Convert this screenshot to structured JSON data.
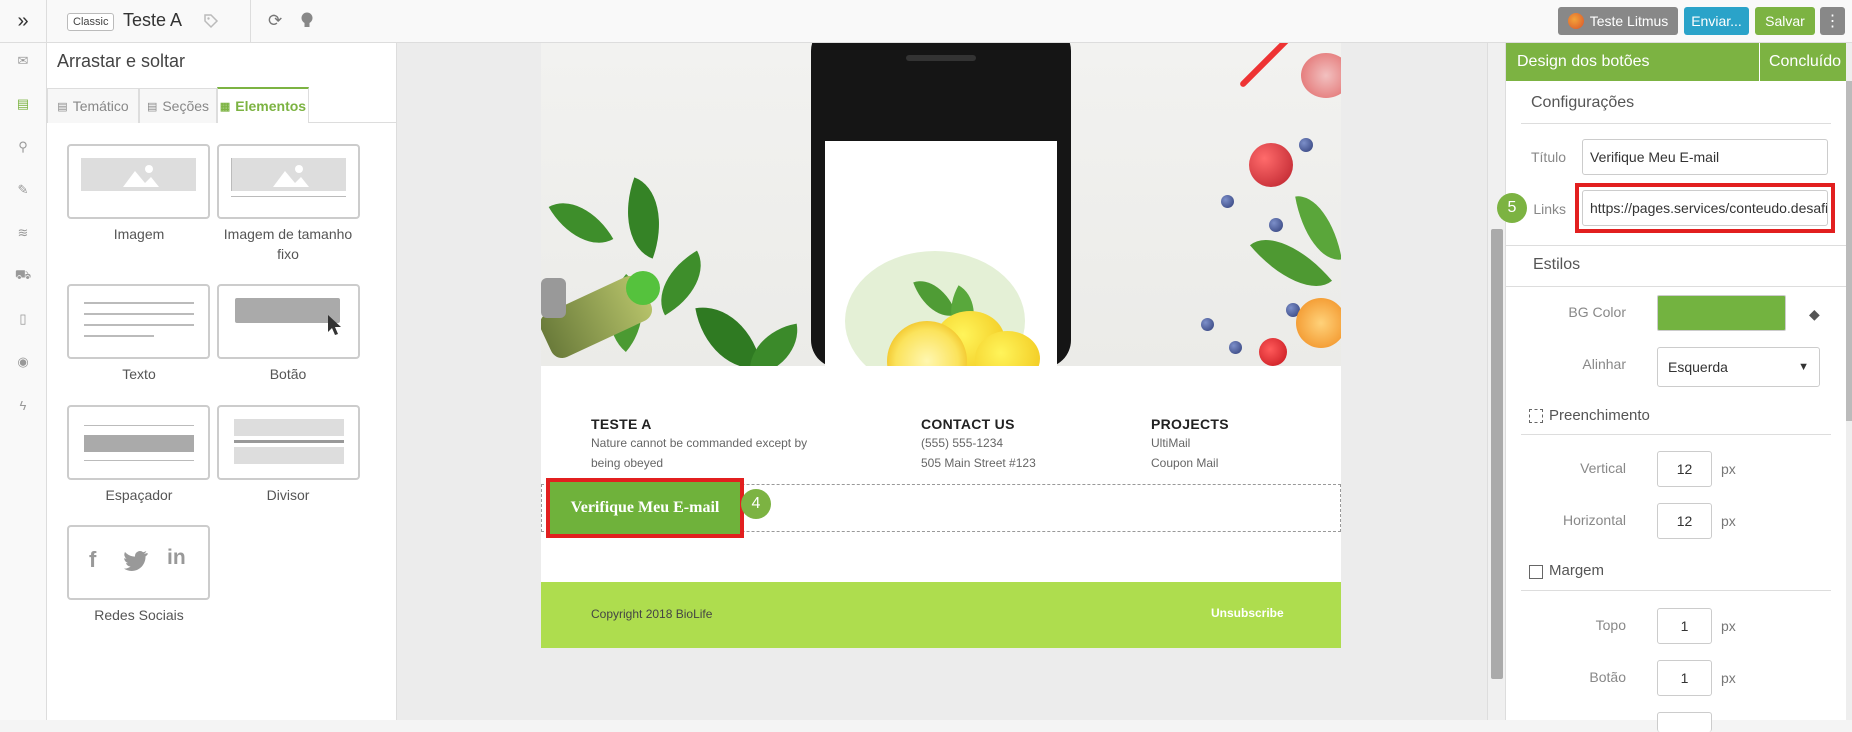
{
  "topbar": {
    "badge": "Classic",
    "title": "Teste A",
    "litmus_label": "Teste Litmus",
    "send_label": "Enviar...",
    "save_label": "Salvar"
  },
  "left_panel": {
    "title": "Arrastar e soltar",
    "tabs": [
      {
        "label": "Temático"
      },
      {
        "label": "Seções"
      },
      {
        "label": "Elementos"
      }
    ],
    "elements": [
      {
        "label": "Imagem"
      },
      {
        "label": "Imagem de tamanho fixo"
      },
      {
        "label": "Texto"
      },
      {
        "label": "Botão"
      },
      {
        "label": "Espaçador"
      },
      {
        "label": "Divisor"
      },
      {
        "label": "Redes Sociais"
      }
    ]
  },
  "email": {
    "columns": [
      {
        "heading": "TESTE A",
        "lines": [
          "Nature cannot be commanded except by",
          "being obeyed"
        ]
      },
      {
        "heading": "CONTACT US",
        "lines": [
          "(555) 555-1234",
          "505 Main Street #123"
        ]
      },
      {
        "heading": "PROJECTS",
        "lines": [
          "UltiMail",
          "Coupon Mail"
        ]
      }
    ],
    "button_label": "Verifique Meu E-mail",
    "step_button": "4",
    "footer_copy": "Copyright 2018 BioLife",
    "footer_unsubscribe": "Unsubscribe"
  },
  "right_panel": {
    "header_title": "Design dos botões",
    "header_done": "Concluído",
    "config_title": "Configurações",
    "title_label": "Título",
    "title_value": "Verifique Meu E-mail",
    "links_label": "Links",
    "links_value": "https://pages.services/conteudo.desafio",
    "step_links": "5",
    "styles_title": "Estilos",
    "bg_color_label": "BG Color",
    "bg_color_value": "#73b340",
    "align_label": "Alinhar",
    "align_value": "Esquerda",
    "padding_title": "Preenchimento",
    "vertical_label": "Vertical",
    "vertical_value": "12",
    "horizontal_label": "Horizontal",
    "horizontal_value": "12",
    "margin_title": "Margem",
    "top_label": "Topo",
    "top_value": "1",
    "bottom_label": "Botão",
    "bottom_value": "1",
    "unit": "px"
  },
  "colors": {
    "accent": "#7cb342",
    "send": "#2aa3c9",
    "footer": "#aedd4e",
    "highlight": "#e21f1f"
  }
}
